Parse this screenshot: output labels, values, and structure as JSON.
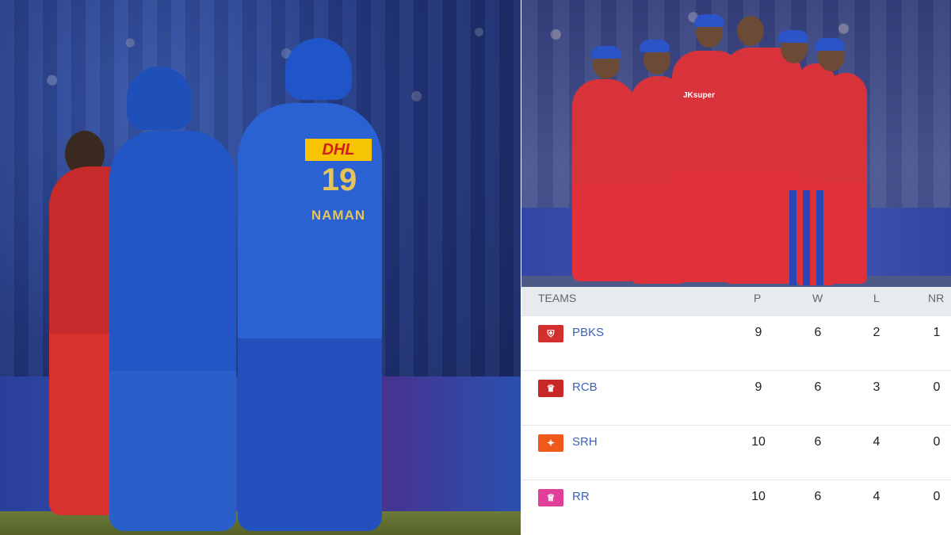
{
  "left_photo": {
    "jersey_sponsor": "DHL",
    "jersey_number": "19",
    "jersey_name": "NAMAN"
  },
  "right_photo": {
    "sponsor": "JKsuper"
  },
  "standings": {
    "headers": {
      "teams": "TEAMS",
      "p": "P",
      "w": "W",
      "l": "L",
      "nr": "NR"
    },
    "rows": [
      {
        "team": "PBKS",
        "p": "9",
        "w": "6",
        "l": "2",
        "nr": "1",
        "logo_color": "#d32f2f",
        "logo_icon": "shield-logo"
      },
      {
        "team": "RCB",
        "p": "9",
        "w": "6",
        "l": "3",
        "nr": "0",
        "logo_color": "#c62828",
        "logo_icon": "lion-logo"
      },
      {
        "team": "SRH",
        "p": "10",
        "w": "6",
        "l": "4",
        "nr": "0",
        "logo_color": "#ef5a1c",
        "logo_icon": "eagle-logo"
      },
      {
        "team": "RR",
        "p": "10",
        "w": "6",
        "l": "4",
        "nr": "0",
        "logo_color": "#e0409a",
        "logo_icon": "crown-logo"
      }
    ],
    "colors": {
      "header_bg": "#e8ebee",
      "team_link": "#3c62b6"
    }
  }
}
